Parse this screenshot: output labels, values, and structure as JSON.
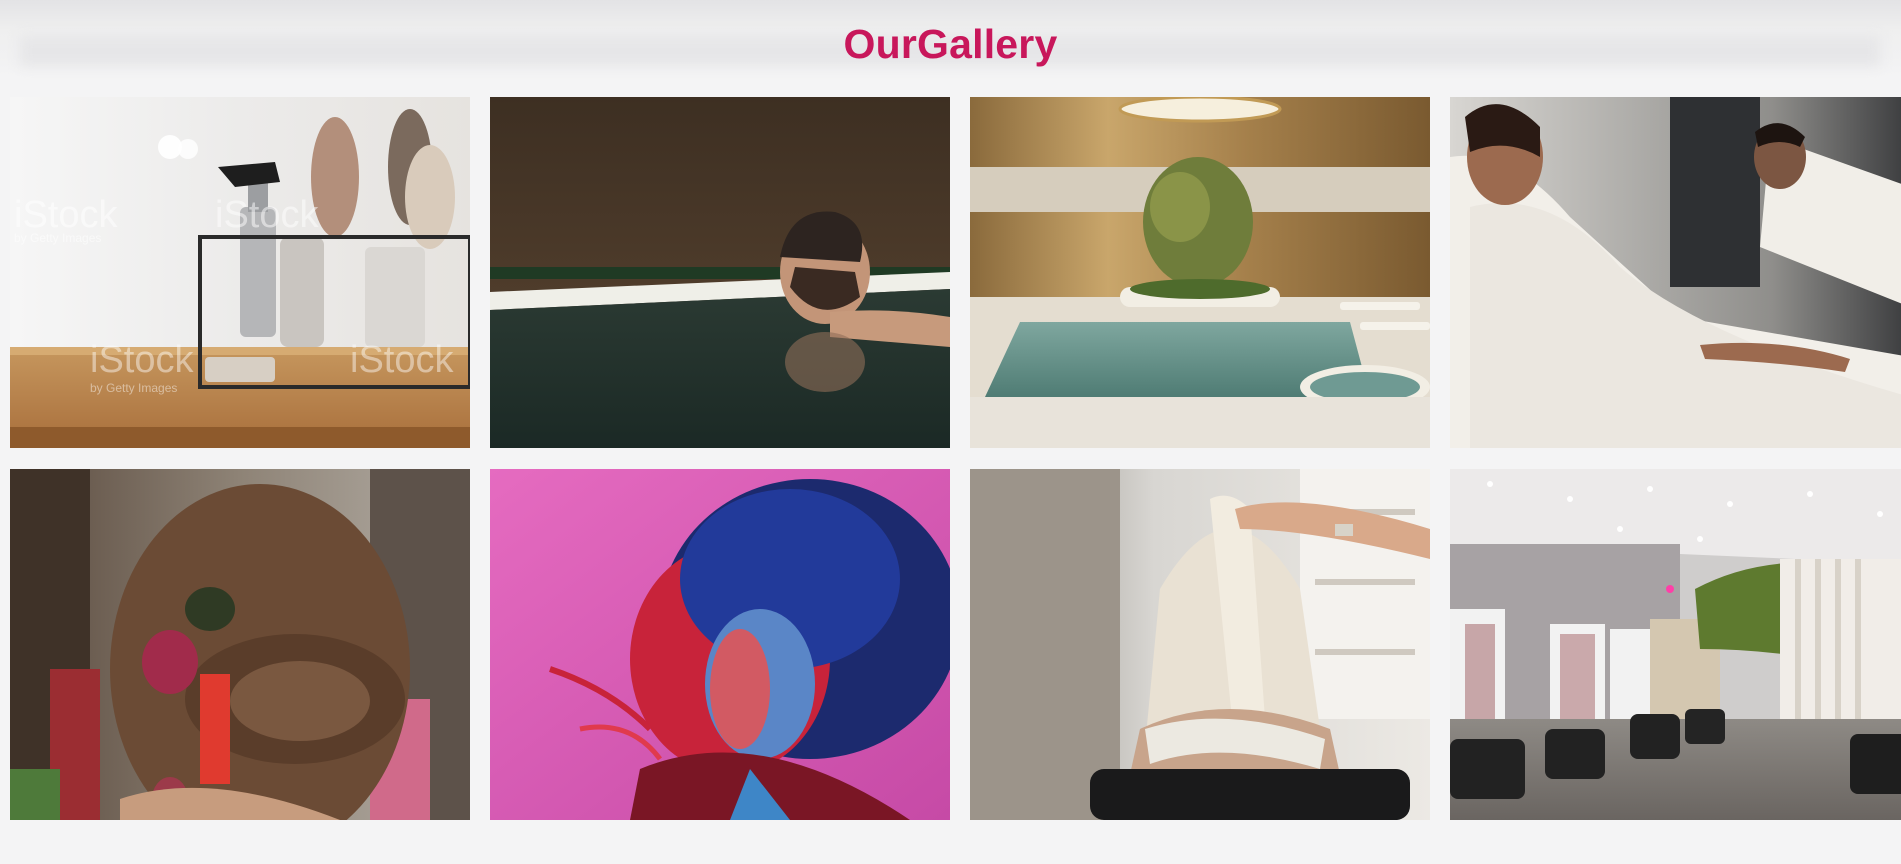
{
  "gallery": {
    "title": "OurGallery",
    "tiles": [
      {
        "subject": "Hair tools in wire basket on wooden shelf",
        "watermark": "iStock",
        "watermark_sub": "by Getty Images"
      },
      {
        "subject": "Man relaxing in pool"
      },
      {
        "subject": "Indoor spa pool with olive tree"
      },
      {
        "subject": "Woman and man in white bathrobes relaxing"
      },
      {
        "subject": "Braided hair bun with hair ornaments"
      },
      {
        "subject": "Curly hair with neon lighting"
      },
      {
        "subject": "Stylist touching long blonde hair"
      },
      {
        "subject": "Hair salon interior with chairs"
      }
    ]
  }
}
